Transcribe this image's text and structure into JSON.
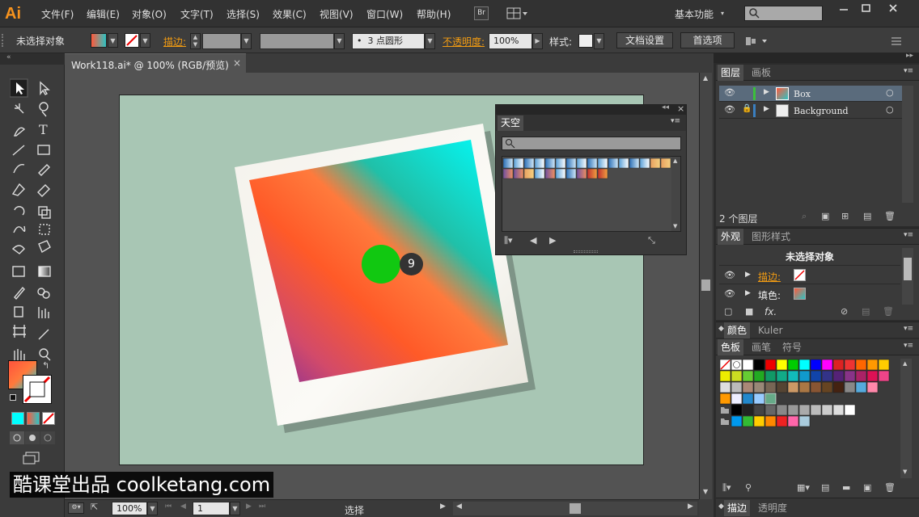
{
  "app": {
    "logo": "Ai"
  },
  "menus": [
    "文件(F)",
    "编辑(E)",
    "对象(O)",
    "文字(T)",
    "选择(S)",
    "效果(C)",
    "视图(V)",
    "窗口(W)",
    "帮助(H)"
  ],
  "menubar": {
    "bridge": "Br",
    "workspace": "基本功能",
    "search_placeholder": ""
  },
  "control": {
    "no_selection": "未选择对象",
    "stroke_label": "描边:",
    "brush_value": "3 点圆形",
    "brush_bullet": "•",
    "opacity_label": "不透明度:",
    "opacity_value": "100%",
    "style_label": "样式:",
    "doc_settings": "文档设置",
    "preferences": "首选项"
  },
  "document": {
    "tab_title": "Work118.ai* @ 100% (RGB/预览)",
    "close": "×"
  },
  "canvas": {
    "badge": "9"
  },
  "sky_panel": {
    "title": "天空",
    "search_placeholder": ""
  },
  "layers_panel": {
    "tabs": [
      "图层",
      "画板"
    ],
    "layers": [
      {
        "name": "Box",
        "color": "#3cbf3c",
        "locked": false,
        "selected": true
      },
      {
        "name": "Background",
        "color": "#3a7ebf",
        "locked": true,
        "selected": false
      }
    ],
    "count": "2 个图层"
  },
  "appearance_panel": {
    "tabs": [
      "外观",
      "图形样式"
    ],
    "title": "未选择对象",
    "rows": [
      {
        "label": "描边:",
        "orange": true
      },
      {
        "label": "填色:",
        "orange": false
      }
    ],
    "fx": "fx."
  },
  "color_panel": {
    "tabs": [
      "颜色",
      "Kuler"
    ]
  },
  "swatches_panel": {
    "tabs": [
      "色板",
      "画笔",
      "符号"
    ]
  },
  "bottom_tabs": [
    "描边",
    "透明度"
  ],
  "status": {
    "zoom": "100%",
    "page": "1",
    "tool": "选择"
  },
  "watermark": "酷课堂出品 coolketang.com",
  "colors": {
    "accent": "#f39c12",
    "artboard": "#a8c6b4",
    "green_dot": "#11c811"
  }
}
